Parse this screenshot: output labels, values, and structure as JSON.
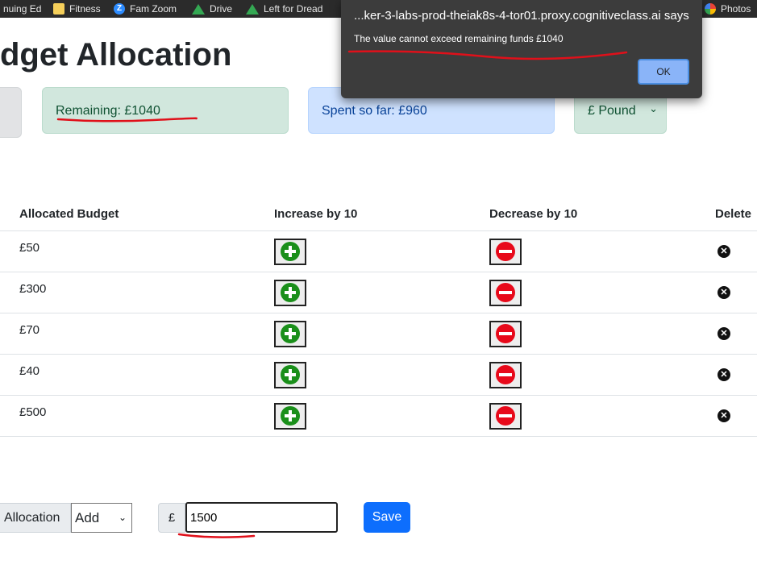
{
  "bookmarks": [
    {
      "label": "nuing Ed",
      "icon": "bookmark-icon"
    },
    {
      "label": "Fitness",
      "icon": "folder-icon"
    },
    {
      "label": "Fam Zoom",
      "icon": "zoom-icon"
    },
    {
      "label": "Drive",
      "icon": "drive-icon"
    },
    {
      "label": "Left for Dread",
      "icon": "drive-icon"
    },
    {
      "label": "Photos",
      "icon": "photos-icon"
    }
  ],
  "zoom_glyph": "Z",
  "page": {
    "title": "dget Allocation"
  },
  "cards": {
    "remaining": "Remaining: £1040",
    "spent": "Spent so far: £960",
    "currency": "£ Pound"
  },
  "table": {
    "headers": [
      "Allocated Budget",
      "Increase by 10",
      "Decrease by 10",
      "Delete"
    ],
    "rows": [
      {
        "budget": "£50"
      },
      {
        "budget": "£300"
      },
      {
        "budget": "£70"
      },
      {
        "budget": "£40"
      },
      {
        "budget": "£500"
      }
    ]
  },
  "form": {
    "allocation_label": "Allocation",
    "action_selected": "Add",
    "currency_prefix": "£",
    "amount_value": "1500",
    "save_label": "Save"
  },
  "dialog": {
    "title": "...ker-3-labs-prod-theiak8s-4-tor01.proxy.cognitiveclass.ai says",
    "message": "The value cannot exceed remaining funds £1040",
    "ok_label": "OK"
  },
  "colors": {
    "annotation": "#e0101a",
    "success_bg": "#d1e7dd",
    "info_bg": "#cfe2ff",
    "primary": "#0d6efd"
  }
}
